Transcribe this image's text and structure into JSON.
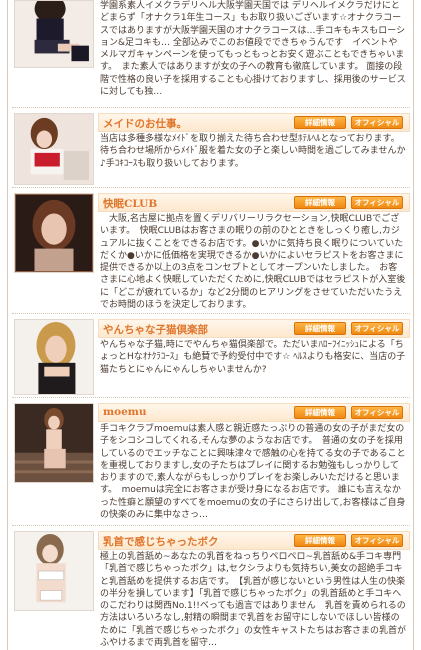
{
  "entries": [
    {
      "name": "",
      "text": "学園系素人イメクラデリヘル大阪学園天国では デリヘルイメクラだけにとどまらず「オナクラ1年生コース」もお取り扱いございます☆オナクラコースではありますが大阪学園天国のオナクラコースは…手コキもキスもローション&足コキも… 全部込みでこのお値段でできちゃうんです　イベントやメルマガキャンペーンを使ってもっともっとお安く遊ぶこともできちゃいます。　また素人ではありますが女の子への教育も徹底しています。 面接の段階で性格の良い子を採用することも心掛けておりますし、採用後のサービスに対しても独…"
    },
    {
      "name": "メイドのお仕事。",
      "text": "当店は多種多様なﾒｲﾄﾞを取り揃えた待ち合わせ型ﾎﾃﾙﾍﾙとなっております。待ち合わせ場所からﾒｲﾄﾞ服を着た女の子と楽しい時間を過ごしてみませんか♪手ｺｷｺｰｽも取り扱いしております。"
    },
    {
      "name": "快眠CLUB",
      "text": "　大阪,名古屋に拠点を置くデリバリーリラクセーション,快眠CLUBでございます。　快眠CLUBはお客さまの眠りの前のひとときをしっくり癒し,カジュアルに抜くことをできるお店です。●いかに気持ち良く眠りについていただくか●いかに低価格を実現できるか●いかによいセラピストをお客さまに提供できるか以上の3点をコンセプトとしてオープンいたしました。　お客さまに心地よく快眠していただくために,快眠CLUBではセラピストが入室後に「どこが疲れているか」など2分間のヒアリングをさせていただいたうえでお時間のほうを決定しております。"
    },
    {
      "name": "やんちゃな子猫倶楽部",
      "text": "やんちゃな子猫,時にでやんちゃ猫倶楽部で。ただいまﾊﾛｰﾌｲﾆｯｼｭによる「ちょっとHなｵﾅｸﾗｺｰｽ」も絶賛で予約受付中です☆ ﾍﾙｽよりも格安に、当店の子猫たちとにゃんにゃんしちゃいませんか?"
    },
    {
      "name": "moemu",
      "text": "手コキクラブmoemuは素人感と親近感たっぷりの普通の女の子がまだ女の子をシコシコしてくれる,そんな夢のようなお店です。　普通の女の子を採用しているのでエッチなことに興味津々で感触の心を持てる女の子であることを重視しておりますし,女の子たちはプレイに関するお勉強もしっかりしておりますので,素人ながらもしっかりプレイをお楽しみいただけると思います。　moemuは完全にお客さまが受け身になるお店です。 誰にも言えなかった性癖と願望のすべてをmoemuの女の子にさらけ出して,お客様はご自身の快楽のみに集中なさっ…"
    },
    {
      "name": "乳首で感じちゃったボク",
      "text": "極上の乳首舐め~あなたの乳首をねっちりペロペロ~乳首舐め&手コキ専門「乳首で感じちゃったボク」は,セクシラよりも気持ちい,美女の超絶手コキと乳首舐めを提供するお店です。　【乳首が感じないという男性は人生の快楽の半分を損しています】「乳首で感じちゃったボク」の乳首舐めと手コキへのこだわりは関西No.1!!ベっても過言ではありません　乳首を責められるの方法はいろいろなし,射精の瞬間まで乳首をお留守にしないでほしい皆様のために「乳首で感じちゃったボク」の女性キャストたちはお客さまの乳首がふやけるまで両乳首を留守…"
    }
  ],
  "buttons": {
    "info": "詳細情報",
    "official": "オフィシャル"
  },
  "colors": {
    "accent": "#e0762b",
    "button": "#f39221",
    "header_band": "#fde8cf"
  }
}
